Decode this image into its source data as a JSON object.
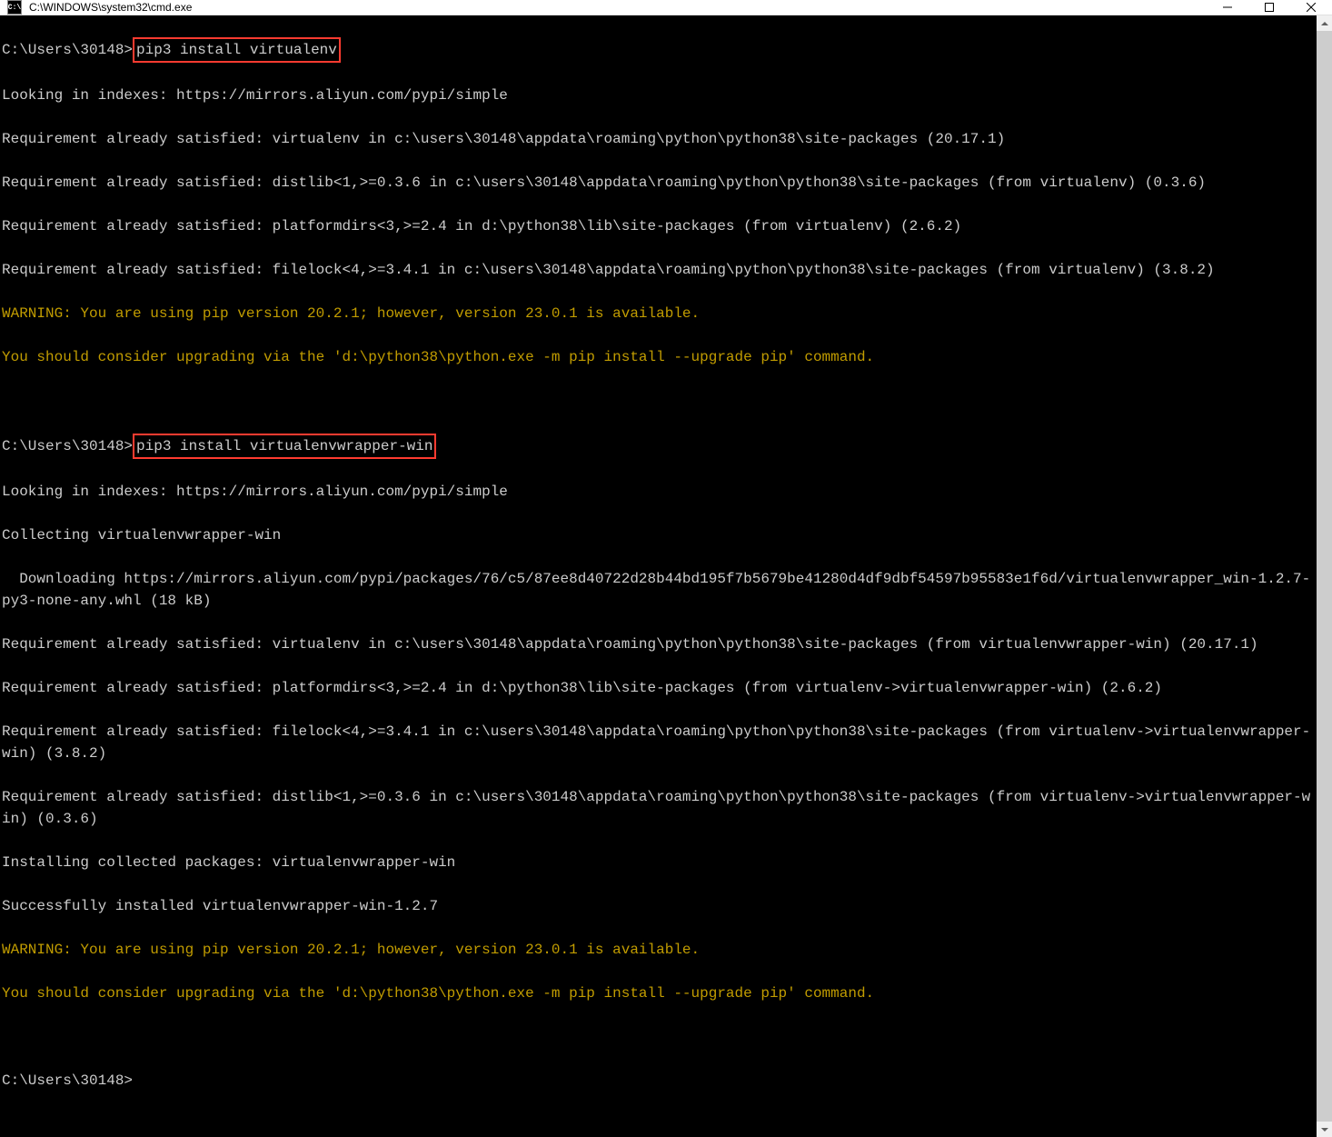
{
  "window": {
    "title": "C:\\WINDOWS\\system32\\cmd.exe",
    "icon_label": "C:\\"
  },
  "terminal": {
    "prompt1": "C:\\Users\\30148>",
    "cmd1": "pip3 install virtualenv",
    "out1_l1": "Looking in indexes: https://mirrors.aliyun.com/pypi/simple",
    "out1_l2": "Requirement already satisfied: virtualenv in c:\\users\\30148\\appdata\\roaming\\python\\python38\\site-packages (20.17.1)",
    "out1_l3": "Requirement already satisfied: distlib<1,>=0.3.6 in c:\\users\\30148\\appdata\\roaming\\python\\python38\\site-packages (from virtualenv) (0.3.6)",
    "out1_l4": "Requirement already satisfied: platformdirs<3,>=2.4 in d:\\python38\\lib\\site-packages (from virtualenv) (2.6.2)",
    "out1_l5": "Requirement already satisfied: filelock<4,>=3.4.1 in c:\\users\\30148\\appdata\\roaming\\python\\python38\\site-packages (from virtualenv) (3.8.2)",
    "warn1_l1": "WARNING: You are using pip version 20.2.1; however, version 23.0.1 is available.",
    "warn1_l2": "You should consider upgrading via the 'd:\\python38\\python.exe -m pip install --upgrade pip' command.",
    "prompt2": "C:\\Users\\30148>",
    "cmd2": "pip3 install virtualenvwrapper-win",
    "out2_l1": "Looking in indexes: https://mirrors.aliyun.com/pypi/simple",
    "out2_l2": "Collecting virtualenvwrapper-win",
    "out2_l3": "  Downloading https://mirrors.aliyun.com/pypi/packages/76/c5/87ee8d40722d28b44bd195f7b5679be41280d4df9dbf54597b95583e1f6d/virtualenvwrapper_win-1.2.7-py3-none-any.whl (18 kB)",
    "out2_l4": "Requirement already satisfied: virtualenv in c:\\users\\30148\\appdata\\roaming\\python\\python38\\site-packages (from virtualenvwrapper-win) (20.17.1)",
    "out2_l5": "Requirement already satisfied: platformdirs<3,>=2.4 in d:\\python38\\lib\\site-packages (from virtualenv->virtualenvwrapper-win) (2.6.2)",
    "out2_l6": "Requirement already satisfied: filelock<4,>=3.4.1 in c:\\users\\30148\\appdata\\roaming\\python\\python38\\site-packages (from virtualenv->virtualenvwrapper-win) (3.8.2)",
    "out2_l7": "Requirement already satisfied: distlib<1,>=0.3.6 in c:\\users\\30148\\appdata\\roaming\\python\\python38\\site-packages (from virtualenv->virtualenvwrapper-win) (0.3.6)",
    "out2_l8": "Installing collected packages: virtualenvwrapper-win",
    "out2_l9": "Successfully installed virtualenvwrapper-win-1.2.7",
    "warn2_l1": "WARNING: You are using pip version 20.2.1; however, version 23.0.1 is available.",
    "warn2_l2": "You should consider upgrading via the 'd:\\python38\\python.exe -m pip install --upgrade pip' command.",
    "prompt3": "C:\\Users\\30148>"
  }
}
